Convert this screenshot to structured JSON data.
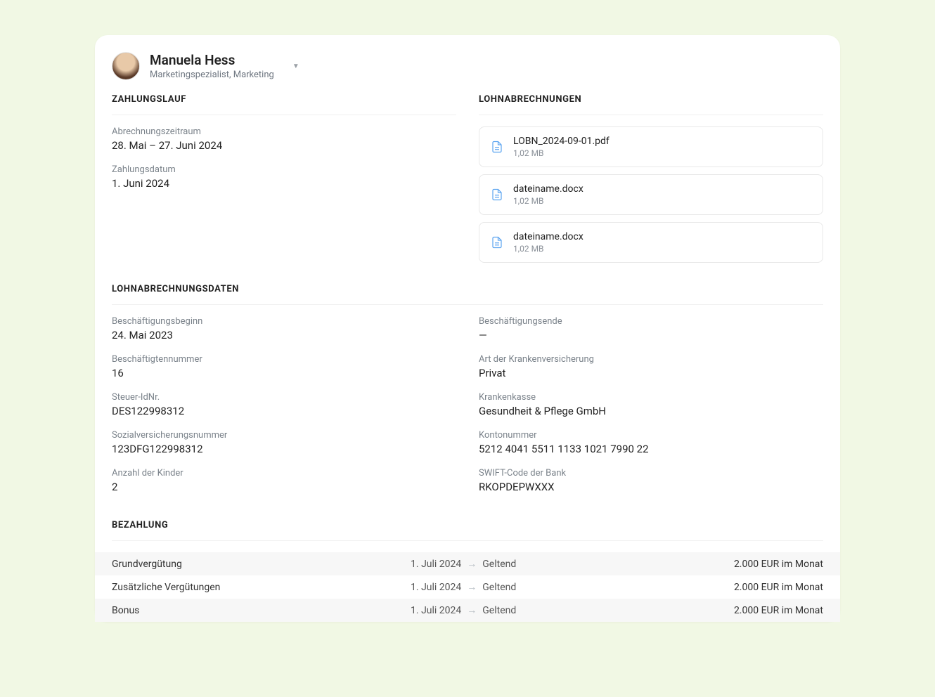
{
  "person": {
    "name": "Manuela Hess",
    "role": "Marketingspezialist, Marketing"
  },
  "sections": {
    "zahlungslauf": "ZAHLUNGSLAUF",
    "lohnabrechnungen": "LOHNABRECHNUNGEN",
    "lohnabrechnungsdaten": "LOHNABRECHNUNGSDATEN",
    "bezahlung": "BEZAHLUNG"
  },
  "zahlungslauf": {
    "abrechnungszeitraum_label": "Abrechnungszeitraum",
    "abrechnungszeitraum_value": "28. Mai – 27. Juni 2024",
    "zahlungsdatum_label": "Zahlungsdatum",
    "zahlungsdatum_value": "1. Juni 2024"
  },
  "files": [
    {
      "name": "LOBN_2024-09-01.pdf",
      "size": "1,02 MB"
    },
    {
      "name": "dateiname.docx",
      "size": "1,02 MB"
    },
    {
      "name": "dateiname.docx",
      "size": "1,02 MB"
    }
  ],
  "daten": {
    "left": [
      {
        "label": "Beschäftigungsbeginn",
        "value": "24. Mai 2023"
      },
      {
        "label": "Beschäftigtennummer",
        "value": "16"
      },
      {
        "label": "Steuer-IdNr.",
        "value": "DES122998312"
      },
      {
        "label": "Sozialversicherungsnummer",
        "value": "123DFG122998312"
      },
      {
        "label": "Anzahl der Kinder",
        "value": "2"
      }
    ],
    "right": [
      {
        "label": "Beschäftigungsende",
        "value": "—"
      },
      {
        "label": "Art der Krankenversicherung",
        "value": "Privat"
      },
      {
        "label": "Krankenkasse",
        "value": "Gesundheit & Pflege GmbH"
      },
      {
        "label": "Kontonummer",
        "value": "5212 4041 5511 1133 1021 7990 22"
      },
      {
        "label": "SWIFT-Code der Bank",
        "value": "RKOPDEPWXXX"
      }
    ]
  },
  "bezahlung": [
    {
      "label": "Grundvergütung",
      "from": "1. Juli 2024",
      "to": "Geltend",
      "amount": "2.000 EUR im Monat"
    },
    {
      "label": "Zusätzliche Vergütungen",
      "from": "1. Juli 2024",
      "to": "Geltend",
      "amount": "2.000 EUR im Monat"
    },
    {
      "label": "Bonus",
      "from": "1. Juli 2024",
      "to": "Geltend",
      "amount": "2.000 EUR im Monat"
    }
  ]
}
